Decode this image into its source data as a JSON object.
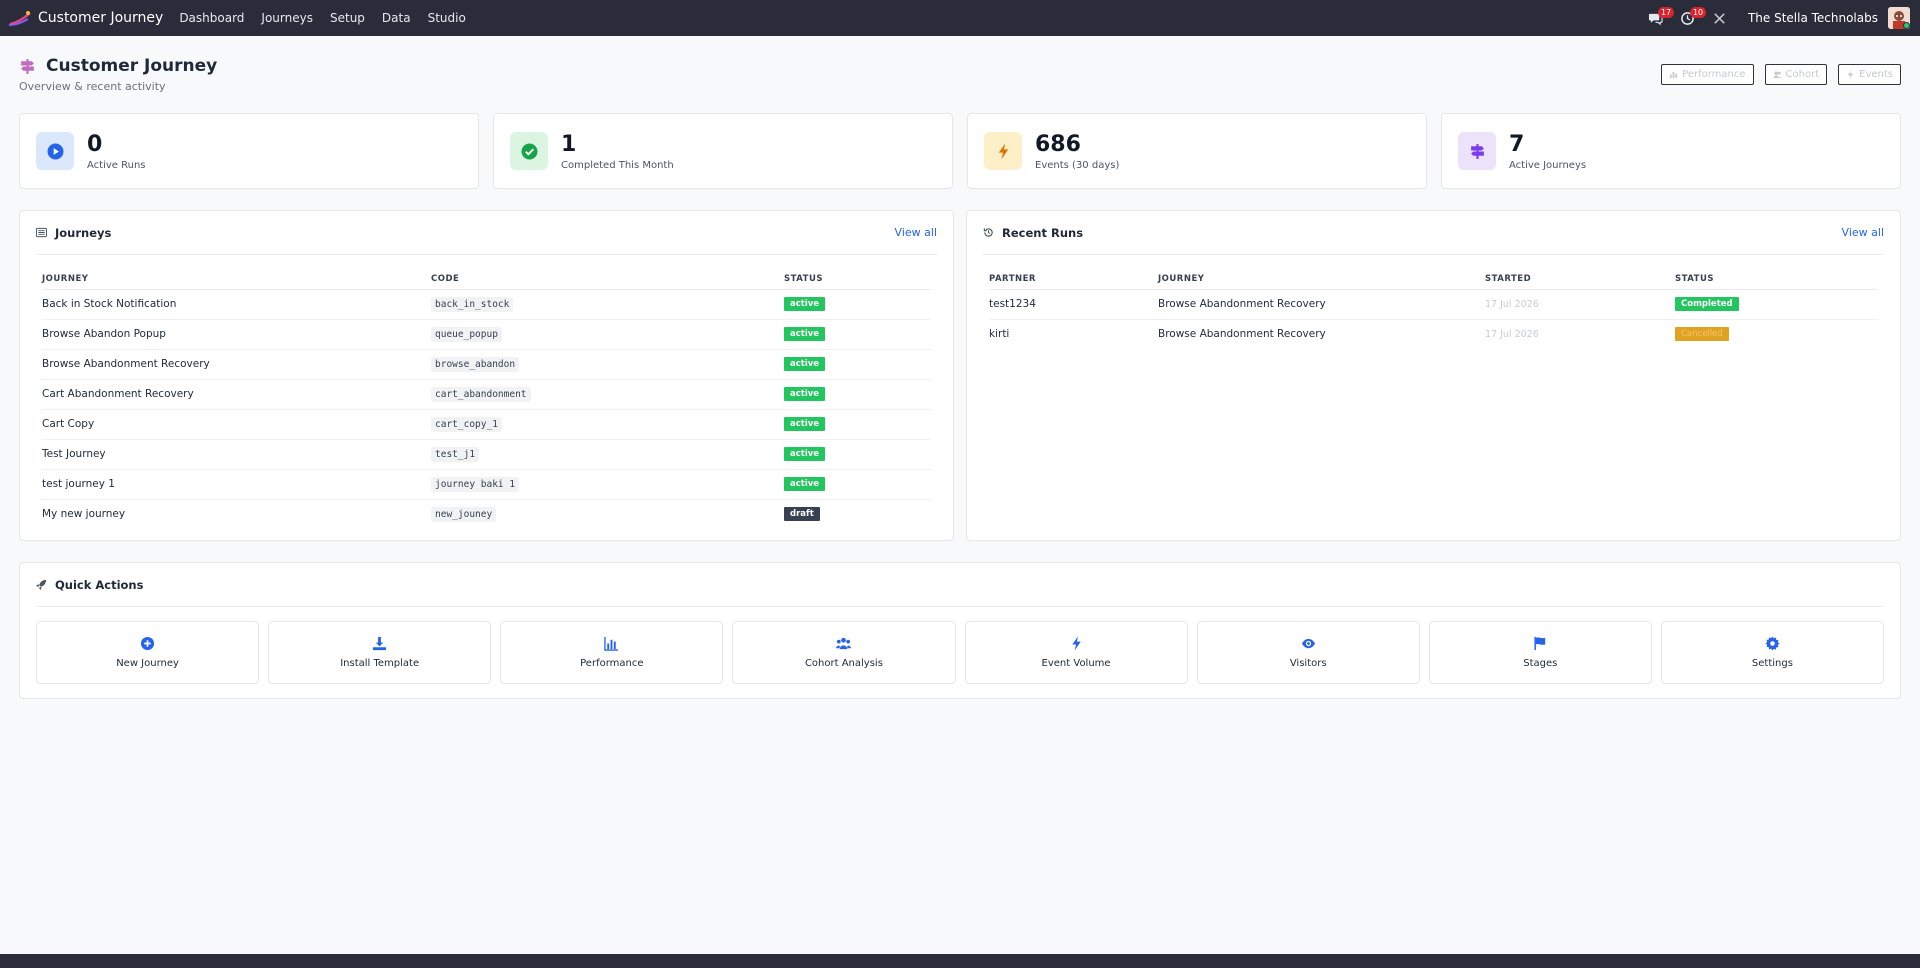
{
  "nav": {
    "brand": "Customer Journey",
    "menu": [
      "Dashboard",
      "Journeys",
      "Setup",
      "Data",
      "Studio"
    ],
    "chat_count": "17",
    "clock_count": "10",
    "company": "The Stella Technolabs"
  },
  "header": {
    "title": "Customer Journey",
    "subtitle": "Overview & recent activity",
    "buttons": [
      "Performance",
      "Cohort",
      "Events"
    ]
  },
  "stats": [
    {
      "value": "0",
      "label": "Active Runs",
      "icon": "play-icon",
      "bg": "#dbe7fb",
      "fg": "#2563eb"
    },
    {
      "value": "1",
      "label": "Completed This Month",
      "icon": "check-icon",
      "bg": "#dcf5e3",
      "fg": "#16a34a"
    },
    {
      "value": "686",
      "label": "Events (30 days)",
      "icon": "bolt-icon",
      "bg": "#fdf0c8",
      "fg": "#d97706"
    },
    {
      "value": "7",
      "label": "Active Journeys",
      "icon": "signpost-icon",
      "bg": "#ece3fb",
      "fg": "#7c3aed"
    }
  ],
  "journeys": {
    "title": "Journeys",
    "view_all": "View all",
    "columns": [
      "JOURNEY",
      "CODE",
      "STATUS"
    ],
    "rows": [
      {
        "name": "Back in Stock Notification",
        "code": "back_in_stock",
        "status": "active"
      },
      {
        "name": "Browse Abandon Popup",
        "code": "queue_popup",
        "status": "active"
      },
      {
        "name": "Browse Abandonment Recovery",
        "code": "browse_abandon",
        "status": "active"
      },
      {
        "name": "Cart Abandonment Recovery",
        "code": "cart_abandonment",
        "status": "active"
      },
      {
        "name": "Cart Copy",
        "code": "cart_copy_1",
        "status": "active"
      },
      {
        "name": "Test Journey",
        "code": "test_j1",
        "status": "active"
      },
      {
        "name": "test journey 1",
        "code": "journey baki 1",
        "status": "active"
      },
      {
        "name": "My new journey",
        "code": "new_jouney",
        "status": "draft"
      }
    ]
  },
  "runs": {
    "title": "Recent Runs",
    "view_all": "View all",
    "columns": [
      "PARTNER",
      "JOURNEY",
      "STARTED",
      "STATUS"
    ],
    "rows": [
      {
        "partner": "test1234",
        "journey": "Browse Abandonment Recovery",
        "started": "17 Jul 2026",
        "status": "Completed"
      },
      {
        "partner": "kirti",
        "journey": "Browse Abandonment Recovery",
        "started": "17 Jul 2026",
        "status": "Cancelled"
      }
    ]
  },
  "quick_actions": {
    "title": "Quick Actions",
    "items": [
      {
        "label": "New Journey",
        "icon": "plus-circle-icon"
      },
      {
        "label": "Install Template",
        "icon": "download-icon"
      },
      {
        "label": "Performance",
        "icon": "bar-chart-icon"
      },
      {
        "label": "Cohort Analysis",
        "icon": "users-icon"
      },
      {
        "label": "Event Volume",
        "icon": "bolt-icon"
      },
      {
        "label": "Visitors",
        "icon": "eye-icon"
      },
      {
        "label": "Stages",
        "icon": "flag-icon"
      },
      {
        "label": "Settings",
        "icon": "gear-icon"
      }
    ]
  },
  "colors": {
    "accent": "#2563eb",
    "active": "#22c55e",
    "draft": "#374151",
    "completed": "#22c55e",
    "cancelled": "#e0a222",
    "navbar": "#2a2d39"
  }
}
